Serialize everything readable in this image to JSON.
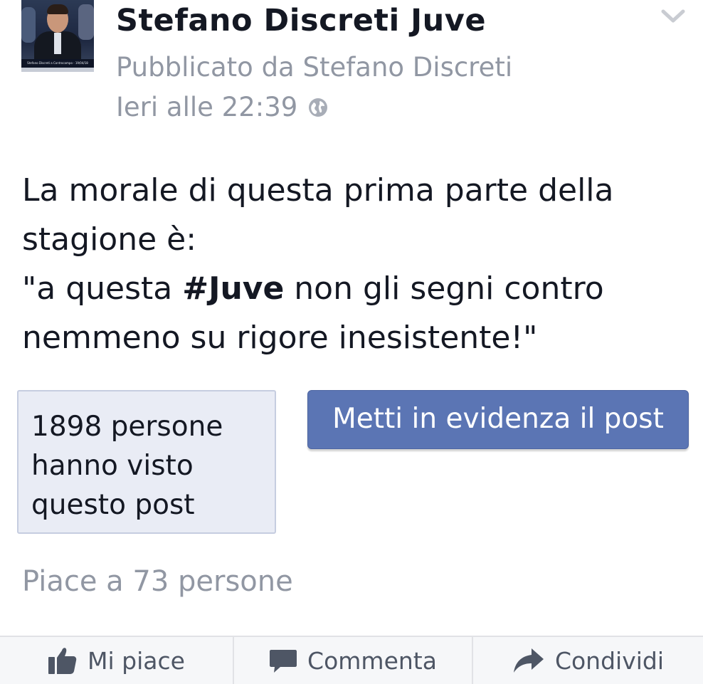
{
  "post": {
    "page_name": "Stefano Discreti Juve",
    "published_by": "Pubblicato da Stefano Discreti",
    "timestamp": "Ieri alle 22:39",
    "avatar_caption": "Stefano Discreti a Controcampo - 19/04/18",
    "text_line1": "La morale di questa prima parte della stagione è:",
    "text_quote_open": "\"a questa ",
    "hashtag": "#Juve",
    "text_quote_rest": " non gli segni contro nemmeno su rigore inesistente!\""
  },
  "insights": {
    "reach_text": "1898 persone hanno visto questo post",
    "boost_label": "Metti in evidenza il post"
  },
  "likes_summary": "Piace a 73 persone",
  "actions": {
    "like_label": "Mi piace",
    "comment_label": "Commenta",
    "share_label": "Condividi"
  },
  "colors": {
    "boost_button": "#5b75b4",
    "reach_box_bg": "#e9ecf5",
    "secondary_text": "#9197a3",
    "action_text": "#4e5665"
  },
  "icons": {
    "menu": "chevron-down-icon",
    "privacy": "globe-icon",
    "like": "thumbs-up-icon",
    "comment": "comment-bubble-icon",
    "share": "share-arrow-icon"
  }
}
